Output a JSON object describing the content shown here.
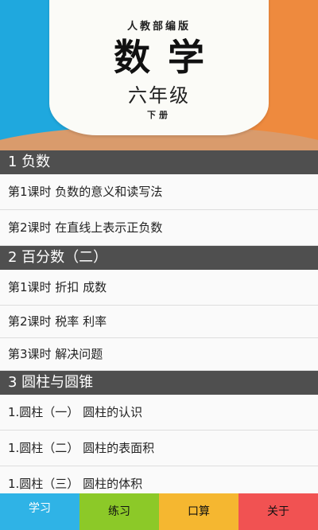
{
  "cover": {
    "publisher": "人教部编版",
    "subject": "数学",
    "grade": "六年级",
    "volume": "下册",
    "colors": {
      "left": "#1fa8de",
      "right": "#ee8a3e",
      "card": "#fbfbf7"
    }
  },
  "sections": [
    {
      "title": "1 负数",
      "lessons": [
        "第1课时 负数的意义和读写法",
        "第2课时 在直线上表示正负数"
      ]
    },
    {
      "title": "2 百分数（二）",
      "lessons": [
        "第1课时 折扣 成数",
        "第2课时 税率 利率",
        "第3课时 解决问题"
      ]
    },
    {
      "title": "3 圆柱与圆锥",
      "lessons": [
        "1.圆柱（一） 圆柱的认识",
        "1.圆柱（二） 圆柱的表面积",
        "1.圆柱（三） 圆柱的体积"
      ]
    }
  ],
  "bottom_nav": [
    {
      "label": "学习",
      "color": "#2fb3e6"
    },
    {
      "label": "练习",
      "color": "#8cc928"
    },
    {
      "label": "口算",
      "color": "#f5b730"
    },
    {
      "label": "关于",
      "color": "#f15252"
    }
  ]
}
